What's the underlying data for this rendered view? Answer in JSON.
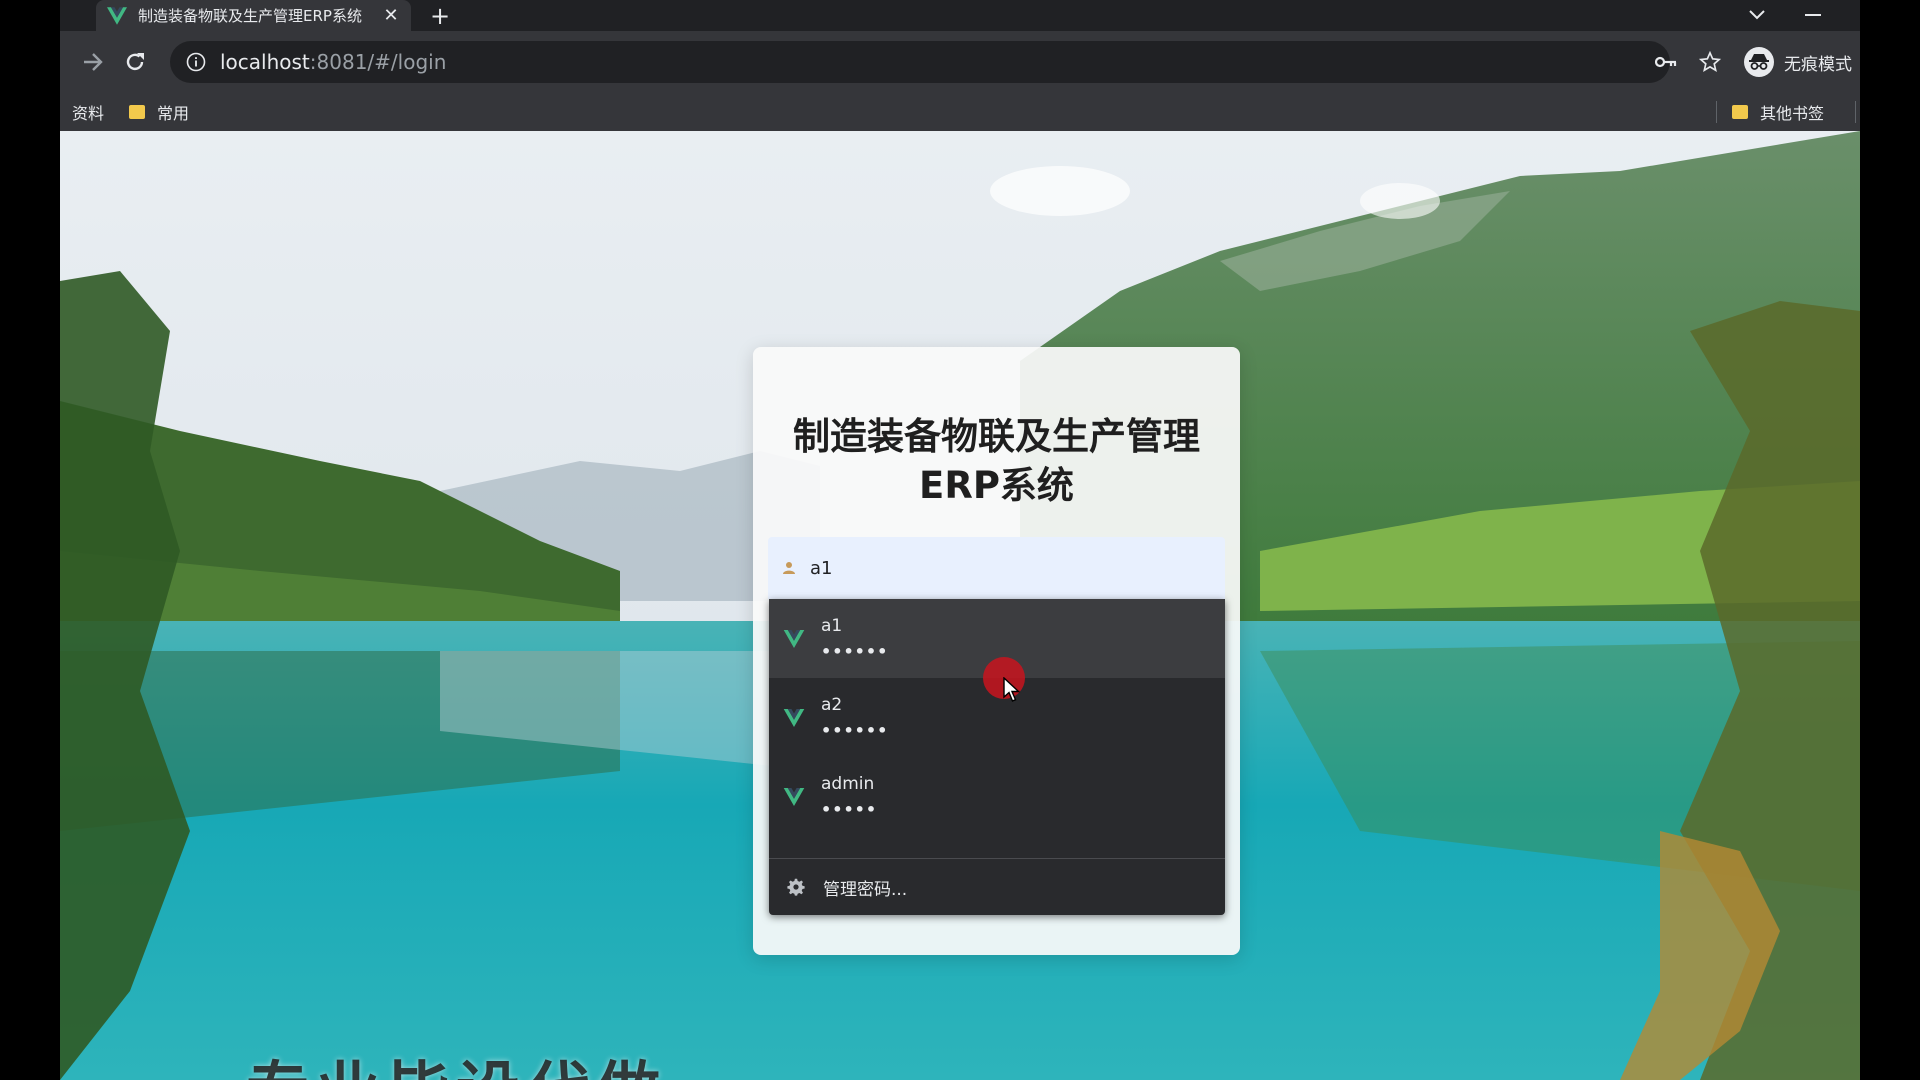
{
  "browser": {
    "tab_title": "制造装备物联及生产管理ERP系统",
    "new_tab_label": "+",
    "close_tab_label": "✕",
    "url_host": "localhost",
    "url_rest": ":8081/#/login",
    "incognito_label": "无痕模式"
  },
  "bookmarks": {
    "items": [
      {
        "label": "资料"
      },
      {
        "label": "常用"
      }
    ],
    "other_label": "其他书签"
  },
  "login": {
    "title_line1": "制造装备物联及生产管理",
    "title_line2": "ERP系统",
    "username_value": "a1"
  },
  "autofill": {
    "entries": [
      {
        "username": "a1",
        "password_mask": "••••••"
      },
      {
        "username": "a2",
        "password_mask": "••••••"
      },
      {
        "username": "admin",
        "password_mask": "•••••"
      }
    ],
    "manage_label": "管理密码..."
  },
  "caption": {
    "text": "专业毕设代做"
  },
  "colors": {
    "vue_green": "#41b883",
    "vue_dark": "#35495e",
    "autofill_bg": "#292a2d",
    "autofill_hover": "#3c3d40",
    "field_bg": "#e8f0fe",
    "cursor_dot": "#c8141e"
  }
}
